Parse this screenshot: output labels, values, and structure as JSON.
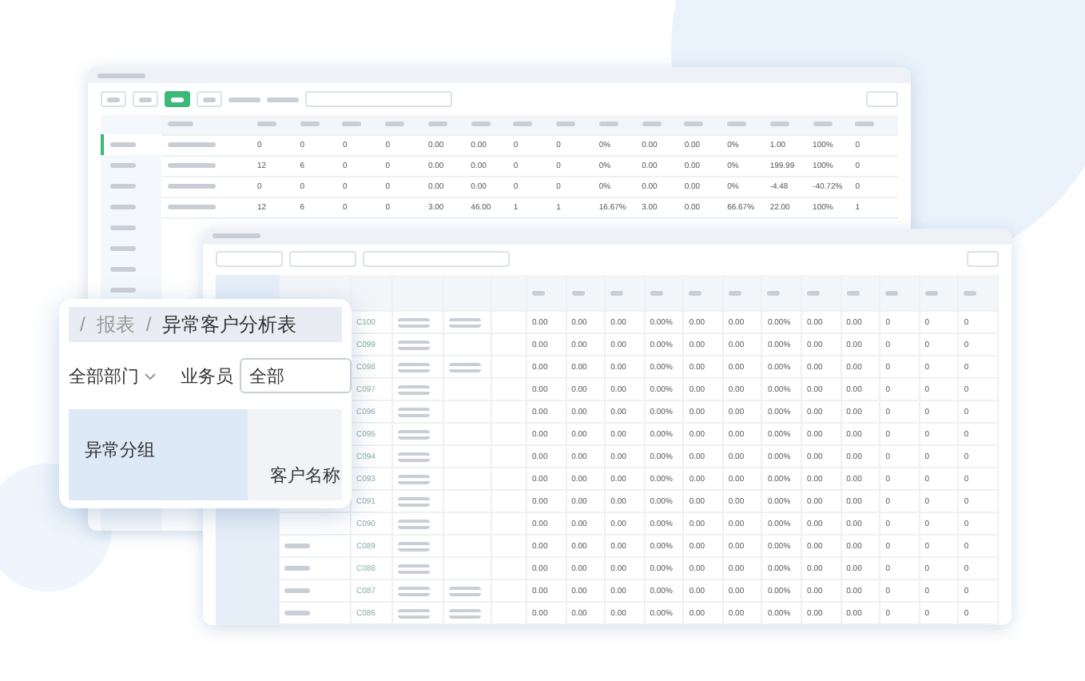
{
  "back_window": {
    "tabs": [
      {
        "selected": false
      },
      {
        "selected": false
      },
      {
        "selected": true
      },
      {
        "selected": false
      }
    ],
    "sidebar_items": [
      {
        "selected": true
      },
      {
        "selected": false
      },
      {
        "selected": false
      },
      {
        "selected": false
      },
      {
        "selected": false
      },
      {
        "selected": false
      },
      {
        "selected": false
      },
      {
        "selected": false
      }
    ],
    "rows": [
      {
        "cells": [
          "0",
          "0",
          "0",
          "0",
          "0.00",
          "0.00",
          "0",
          "0",
          "0%",
          "0.00",
          "0.00",
          "0%",
          "1.00",
          "100%",
          "0"
        ]
      },
      {
        "cells": [
          "12",
          "6",
          "0",
          "0",
          "0.00",
          "0.00",
          "0",
          "0",
          "0%",
          "0.00",
          "0.00",
          "0%",
          "199.99",
          "100%",
          "0"
        ]
      },
      {
        "cells": [
          "0",
          "0",
          "0",
          "0",
          "0.00",
          "0.00",
          "0",
          "0",
          "0%",
          "0.00",
          "0.00",
          "0%",
          "-4.48",
          "-40.72%",
          "0"
        ]
      },
      {
        "cells": [
          "12",
          "6",
          "0",
          "0",
          "3.00",
          "46.00",
          "1",
          "1",
          "16.67%",
          "3.00",
          "0.00",
          "66.67%",
          "22.00",
          "100%",
          "1"
        ]
      }
    ]
  },
  "report_window": {
    "rows": [
      {
        "code": "C100",
        "tag": true,
        "cells": [
          "0.00",
          "0.00",
          "0.00",
          "0.00%",
          "0.00",
          "0.00",
          "0.00%",
          "0.00",
          "0.00",
          "0",
          "0",
          "0"
        ]
      },
      {
        "code": "C099",
        "tag": false,
        "cells": [
          "0.00",
          "0.00",
          "0.00",
          "0.00%",
          "0.00",
          "0.00",
          "0.00%",
          "0.00",
          "0.00",
          "0",
          "0",
          "0"
        ]
      },
      {
        "code": "C098",
        "tag": true,
        "cells": [
          "0.00",
          "0.00",
          "0.00",
          "0.00%",
          "0.00",
          "0.00",
          "0.00%",
          "0.00",
          "0.00",
          "0",
          "0",
          "0"
        ]
      },
      {
        "code": "C097",
        "tag": false,
        "cells": [
          "0.00",
          "0.00",
          "0.00",
          "0.00%",
          "0.00",
          "0.00",
          "0.00%",
          "0.00",
          "0.00",
          "0",
          "0",
          "0"
        ]
      },
      {
        "code": "C096",
        "tag": false,
        "cells": [
          "0.00",
          "0.00",
          "0.00",
          "0.00%",
          "0.00",
          "0.00",
          "0.00%",
          "0.00",
          "0.00",
          "0",
          "0",
          "0"
        ]
      },
      {
        "code": "C095",
        "tag": false,
        "cells": [
          "0.00",
          "0.00",
          "0.00",
          "0.00%",
          "0.00",
          "0.00",
          "0.00%",
          "0.00",
          "0.00",
          "0",
          "0",
          "0"
        ]
      },
      {
        "code": "C094",
        "tag": false,
        "cells": [
          "0.00",
          "0.00",
          "0.00",
          "0.00%",
          "0.00",
          "0.00",
          "0.00%",
          "0.00",
          "0.00",
          "0",
          "0",
          "0"
        ]
      },
      {
        "code": "C093",
        "tag": false,
        "cells": [
          "0.00",
          "0.00",
          "0.00",
          "0.00%",
          "0.00",
          "0.00",
          "0.00%",
          "0.00",
          "0.00",
          "0",
          "0",
          "0"
        ]
      },
      {
        "code": "C091",
        "tag": false,
        "cells": [
          "0.00",
          "0.00",
          "0.00",
          "0.00%",
          "0.00",
          "0.00",
          "0.00%",
          "0.00",
          "0.00",
          "0",
          "0",
          "0"
        ]
      },
      {
        "code": "C090",
        "tag": false,
        "cells": [
          "0.00",
          "0.00",
          "0.00",
          "0.00%",
          "0.00",
          "0.00",
          "0.00%",
          "0.00",
          "0.00",
          "0",
          "0",
          "0"
        ]
      },
      {
        "code": "C089",
        "tag": false,
        "cells": [
          "0.00",
          "0.00",
          "0.00",
          "0.00%",
          "0.00",
          "0.00",
          "0.00%",
          "0.00",
          "0.00",
          "0",
          "0",
          "0"
        ]
      },
      {
        "code": "C088",
        "tag": false,
        "cells": [
          "0.00",
          "0.00",
          "0.00",
          "0.00%",
          "0.00",
          "0.00",
          "0.00%",
          "0.00",
          "0.00",
          "0",
          "0",
          "0"
        ]
      },
      {
        "code": "C087",
        "tag": true,
        "cells": [
          "0.00",
          "0.00",
          "0.00",
          "0.00%",
          "0.00",
          "0.00",
          "0.00%",
          "0.00",
          "0.00",
          "0",
          "0",
          "0"
        ]
      },
      {
        "code": "C086",
        "tag": true,
        "cells": [
          "0.00",
          "0.00",
          "0.00",
          "0.00%",
          "0.00",
          "0.00",
          "0.00%",
          "0.00",
          "0.00",
          "0",
          "0",
          "0"
        ]
      }
    ]
  },
  "callout": {
    "breadcrumb": [
      "/",
      "报表",
      "/",
      "异常客户分析表"
    ],
    "department_filter": "全部部门",
    "salesman_label": "业务员",
    "salesman_value": "全部",
    "group_header": "异常分组",
    "name_header": "客户名称"
  }
}
